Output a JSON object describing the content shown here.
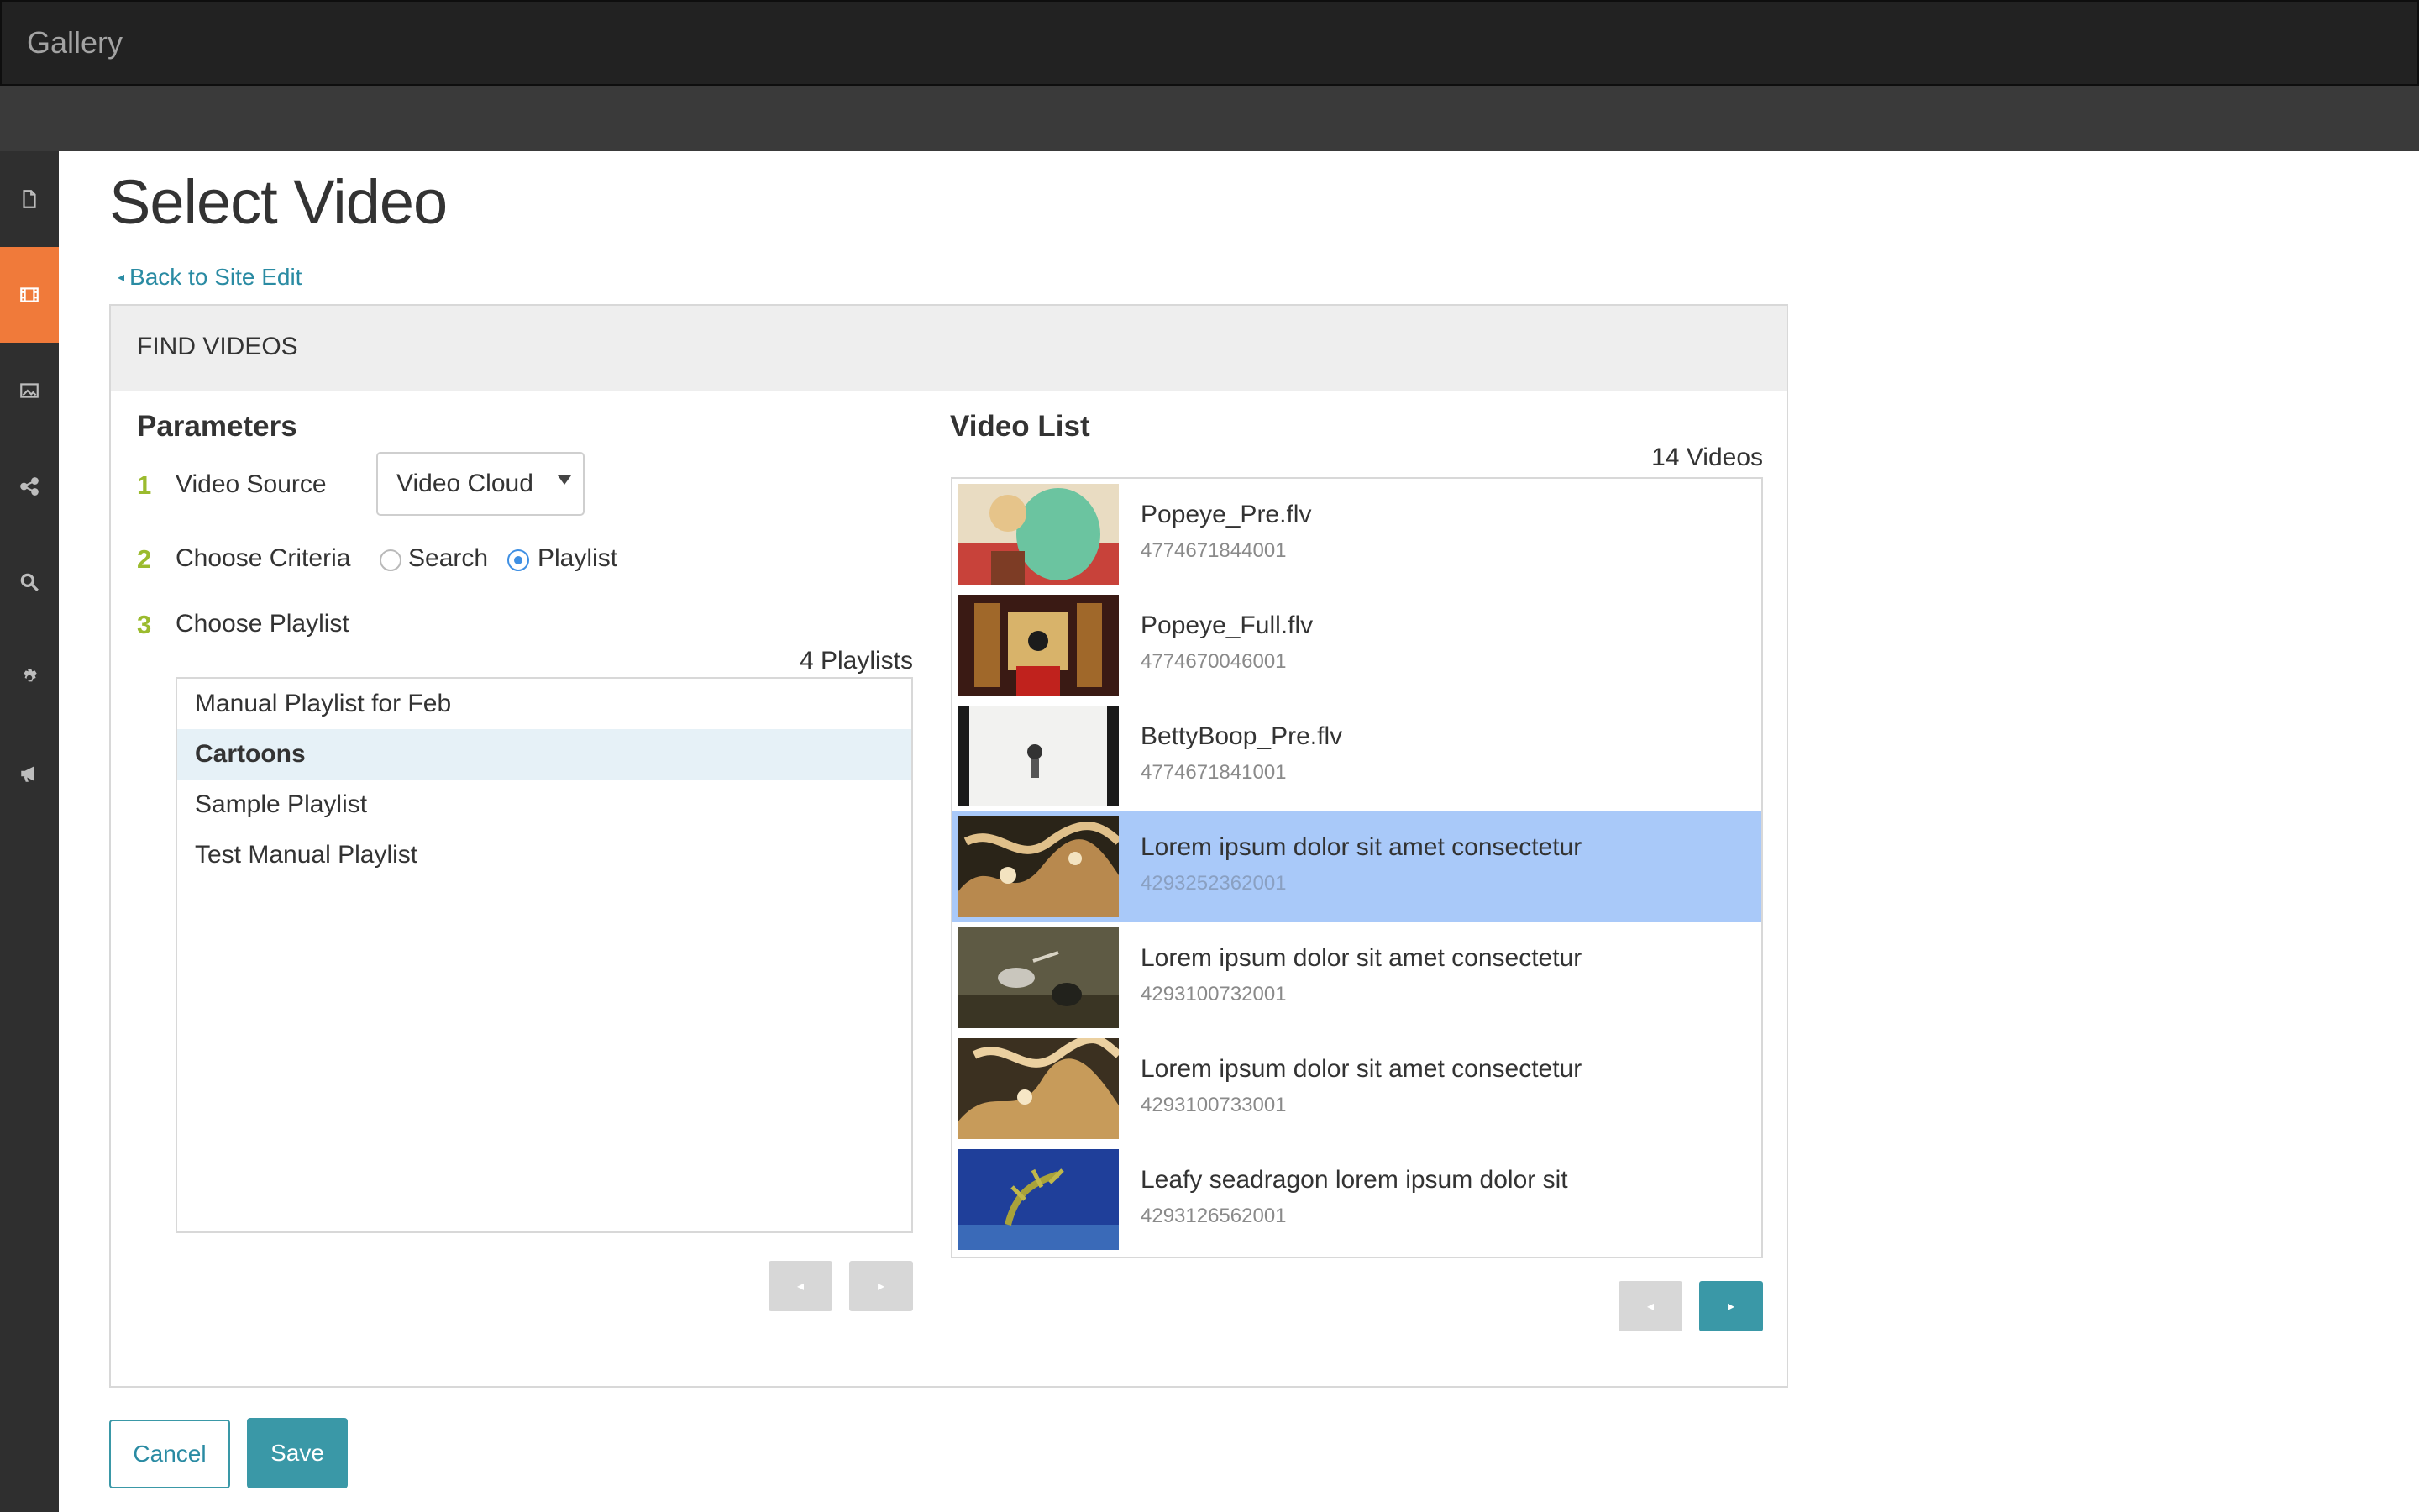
{
  "app": {
    "title": "Gallery"
  },
  "sidebar": {
    "items": [
      {
        "icon": "page-icon",
        "active": false
      },
      {
        "icon": "film-icon",
        "active": true
      },
      {
        "icon": "image-icon",
        "active": false
      },
      {
        "icon": "share-icon",
        "active": false
      },
      {
        "icon": "search-icon",
        "active": false
      },
      {
        "icon": "gear-icon",
        "active": false
      },
      {
        "icon": "megaphone-icon",
        "active": false
      }
    ],
    "accent_color": "#f07a3a"
  },
  "page": {
    "title": "Select Video",
    "back_link": "Back to Site Edit"
  },
  "panel": {
    "header": "FIND VIDEOS",
    "parameters": {
      "title": "Parameters",
      "steps": [
        {
          "num": "1",
          "label": "Video Source"
        },
        {
          "num": "2",
          "label": "Choose Criteria"
        },
        {
          "num": "3",
          "label": "Choose Playlist"
        }
      ],
      "video_source_value": "Video Cloud",
      "criteria_options": [
        {
          "label": "Search",
          "checked": false
        },
        {
          "label": "Playlist",
          "checked": true
        }
      ],
      "playlist_count": "4 Playlists",
      "playlists": [
        {
          "label": "Manual Playlist for Feb",
          "selected": false
        },
        {
          "label": "Cartoons",
          "selected": true
        },
        {
          "label": "Sample Playlist",
          "selected": false
        },
        {
          "label": "Test Manual Playlist",
          "selected": false
        }
      ]
    },
    "video_list": {
      "title": "Video List",
      "count": "14 Videos",
      "videos": [
        {
          "title": "Popeye_Pre.flv",
          "id": "4774671844001",
          "selected": false,
          "thumb": "cartoon-green"
        },
        {
          "title": "Popeye_Full.flv",
          "id": "4774670046001",
          "selected": false,
          "thumb": "cartoon-stage"
        },
        {
          "title": "BettyBoop_Pre.flv",
          "id": "4774671841001",
          "selected": false,
          "thumb": "cartoon-bw"
        },
        {
          "title": "Lorem ipsum dolor sit amet consectetur",
          "id": "4293252362001",
          "selected": true,
          "thumb": "coral"
        },
        {
          "title": "Lorem ipsum dolor sit amet consectetur",
          "id": "4293100732001",
          "selected": false,
          "thumb": "birds"
        },
        {
          "title": "Lorem ipsum dolor sit amet consectetur",
          "id": "4293100733001",
          "selected": false,
          "thumb": "coral"
        },
        {
          "title": "Leafy seadragon lorem ipsum dolor sit",
          "id": "4293126562001",
          "selected": false,
          "thumb": "seadragon"
        }
      ]
    }
  },
  "actions": {
    "cancel": "Cancel",
    "save": "Save"
  },
  "colors": {
    "primary": "#3a98a7",
    "step_number": "#9bbb2e",
    "selected_row": "#a9c9f9"
  }
}
